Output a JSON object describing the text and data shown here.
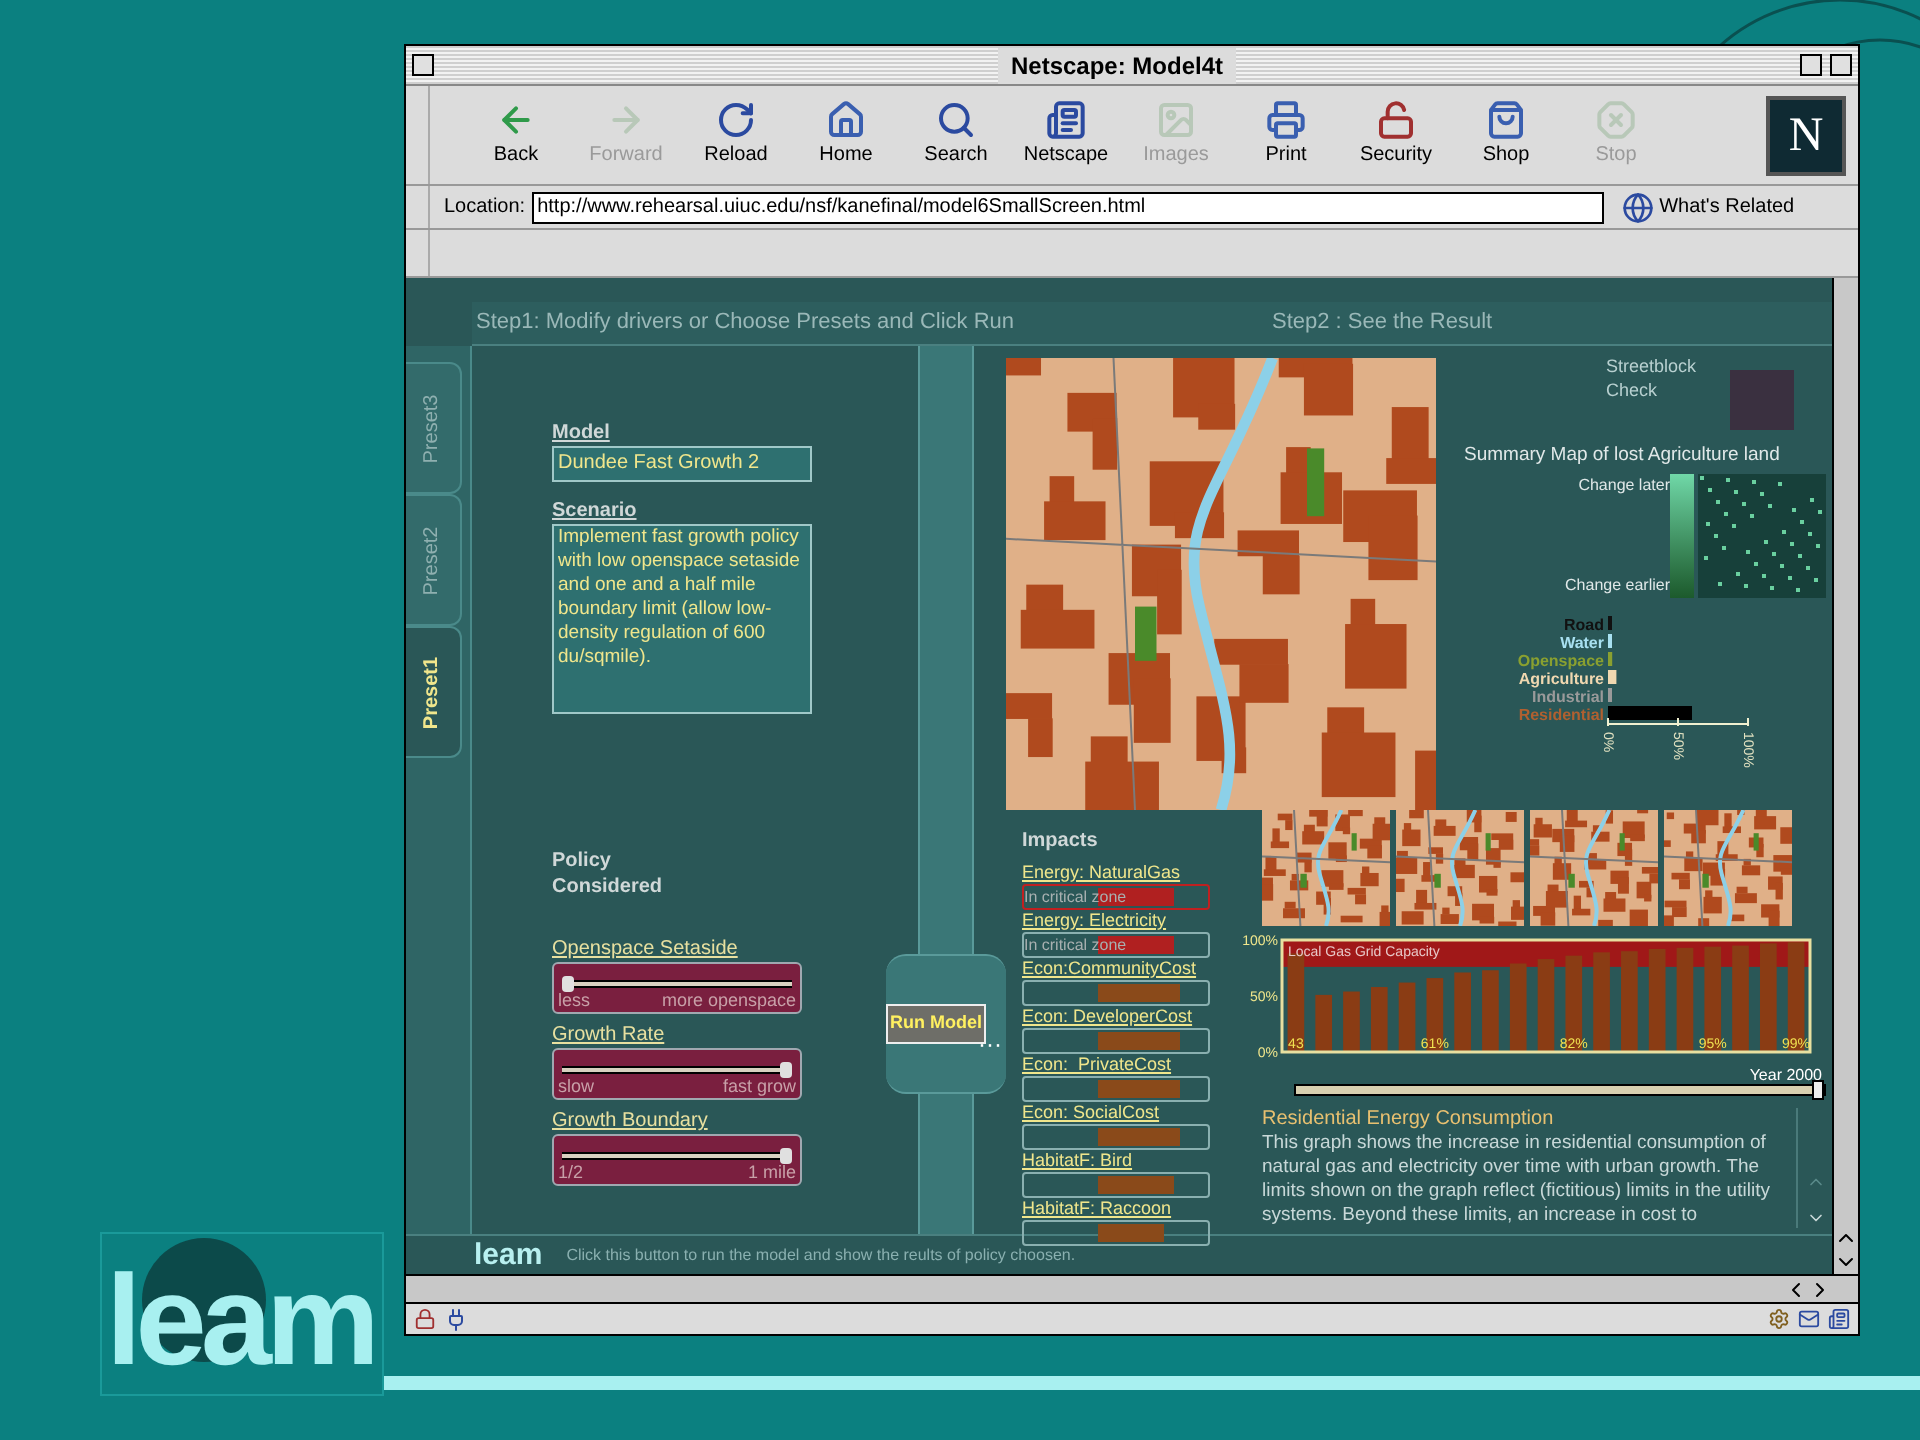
{
  "slide": {
    "logo": "leam"
  },
  "browser": {
    "title": "Netscape: Model4t",
    "logo_letter": "N",
    "toolbar": [
      {
        "label": "Back",
        "disabled": false
      },
      {
        "label": "Forward",
        "disabled": true
      },
      {
        "label": "Reload",
        "disabled": false
      },
      {
        "label": "Home",
        "disabled": false
      },
      {
        "label": "Search",
        "disabled": false
      },
      {
        "label": "Netscape",
        "disabled": false
      },
      {
        "label": "Images",
        "disabled": true
      },
      {
        "label": "Print",
        "disabled": false
      },
      {
        "label": "Security",
        "disabled": false
      },
      {
        "label": "Shop",
        "disabled": false
      },
      {
        "label": "Stop",
        "disabled": true
      }
    ],
    "location": {
      "label": "Location:",
      "url": "http://www.rehearsal.uiuc.edu/nsf/kanefinal/model6SmallScreen.html"
    },
    "whats_related": "What's Related"
  },
  "page": {
    "step1": "Step1: Modify drivers or Choose Presets and Click Run",
    "step2": "Step2 : See the Result",
    "presets": [
      {
        "label": "Preset3",
        "selected": false
      },
      {
        "label": "Preset2",
        "selected": false
      },
      {
        "label": "Preset1",
        "selected": true
      }
    ],
    "model": {
      "label": "Model",
      "value": "Dundee Fast Growth 2"
    },
    "scenario": {
      "label": "Scenario",
      "value": "Implement fast growth policy with low openspace setaside and one and a half mile boundary limit (allow low-density regulation of 600 du/sqmile)."
    },
    "policy_heading": "Policy Considered",
    "policies": [
      {
        "label": "Openspace Setaside",
        "level": 0,
        "min_label": "less",
        "max_label": "more openspace"
      },
      {
        "label": "Growth Rate",
        "level": 1,
        "min_label": "slow",
        "max_label": "fast grow"
      },
      {
        "label": "Growth Boundary",
        "level": 1,
        "min_label": "1/2",
        "max_label": "1 mile"
      }
    ],
    "run_button": "Run Model",
    "run_ellipsis": "···",
    "impacts": {
      "heading": "Impacts",
      "items": [
        {
          "label": "Energy: NaturalGas",
          "selected": true,
          "critical": true,
          "note": "In critical zone",
          "level": 0.7
        },
        {
          "label": "Energy: Electricity",
          "selected": false,
          "critical": true,
          "note": "In critical zone",
          "level": 0.7
        },
        {
          "label": "Econ:CommunityCost",
          "selected": false,
          "critical": false,
          "level": 0.75
        },
        {
          "label": "Econ: DeveloperCost",
          "selected": false,
          "critical": false,
          "level": 0.75
        },
        {
          "label": "Econ:  PrivateCost",
          "selected": false,
          "critical": false,
          "level": 0.75
        },
        {
          "label": "Econ: SocialCost",
          "selected": false,
          "critical": false,
          "level": 0.75
        },
        {
          "label": "HabitatF: Bird",
          "selected": false,
          "critical": false,
          "level": 0.7
        },
        {
          "label": "HabitatF: Raccoon",
          "selected": false,
          "critical": false,
          "level": 0.6
        }
      ]
    },
    "streetblock": "Streetblock Check",
    "summary": {
      "title": "Summary Map of lost Agriculture land",
      "later": "Change later",
      "earlier": "Change earlier"
    },
    "land_use": {
      "legend": [
        {
          "color": "#111111"
        },
        {
          "color": "#a8e0f0"
        },
        {
          "color": "#8aa030"
        },
        {
          "color": "#f0d8b0"
        },
        {
          "color": "#9a9a9a"
        },
        {
          "color": "#b06030"
        }
      ],
      "chart_data": {
        "type": "bar",
        "orientation": "horizontal",
        "categories": [
          "Road",
          "Water",
          "Openspace",
          "Agriculture",
          "Industrial",
          "Residential"
        ],
        "stacked": true,
        "series": [
          {
            "color": "#111111",
            "values": [
              2,
              null,
              null,
              null,
              null,
              null
            ]
          },
          {
            "color": "#a8e0f0",
            "values": [
              null,
              2,
              null,
              null,
              null,
              null
            ]
          },
          {
            "color": "#8aa030",
            "values": [
              null,
              null,
              3,
              null,
              null,
              null
            ]
          },
          {
            "color": "#f0d8b0",
            "values": [
              null,
              null,
              null,
              6,
              null,
              null
            ]
          },
          {
            "color": "#9a9a9a",
            "values": [
              null,
              null,
              null,
              null,
              2,
              null
            ]
          },
          {
            "color": "#000000",
            "values": [
              null,
              null,
              null,
              null,
              null,
              60
            ]
          }
        ],
        "xlim": [
          0,
          100
        ],
        "xticks": [
          {
            "value": 0,
            "label": "0%"
          },
          {
            "value": 50,
            "label": "50%"
          },
          {
            "value": 100,
            "label": "100%"
          }
        ]
      }
    },
    "energy": {
      "chart_data": {
        "type": "bar",
        "ylim": [
          0,
          100
        ],
        "bands": [
          {
            "axis": "y",
            "from": 76,
            "to": 100,
            "label": "Local Gas Grid Capacity",
            "color": "#a01818"
          }
        ],
        "yticks": [
          {
            "value": 0,
            "label": "0%"
          },
          {
            "value": 50,
            "label": "50%"
          },
          {
            "value": 100,
            "label": "100%"
          }
        ],
        "categories": [
          "43",
          null,
          null,
          null,
          null,
          "61%",
          null,
          null,
          null,
          null,
          "82%",
          null,
          null,
          null,
          null,
          "95%",
          null,
          null,
          "99%"
        ],
        "series": [
          {
            "color": "#8a3c14",
            "values": [
              88,
              51,
              54,
              58,
              62,
              66,
              71,
              73,
              79,
              83,
              86,
              89,
              90,
              92,
              93,
              94,
              95,
              97,
              98
            ]
          }
        ]
      }
    },
    "timeline": {
      "label": "Year 2000",
      "level": 1
    },
    "description": {
      "title": "Residential Energy Consumption",
      "text": "This graph shows the increase in residential consumption of natural gas and electricity over time with urban growth. The limits shown on the graph reflect (fictitious) limits in the utility systems.  Beyond these limits, an increase in cost to"
    },
    "footer": {
      "logo": "leam",
      "hint": "Click this button to run the model and show the reults of policy choosen."
    }
  }
}
